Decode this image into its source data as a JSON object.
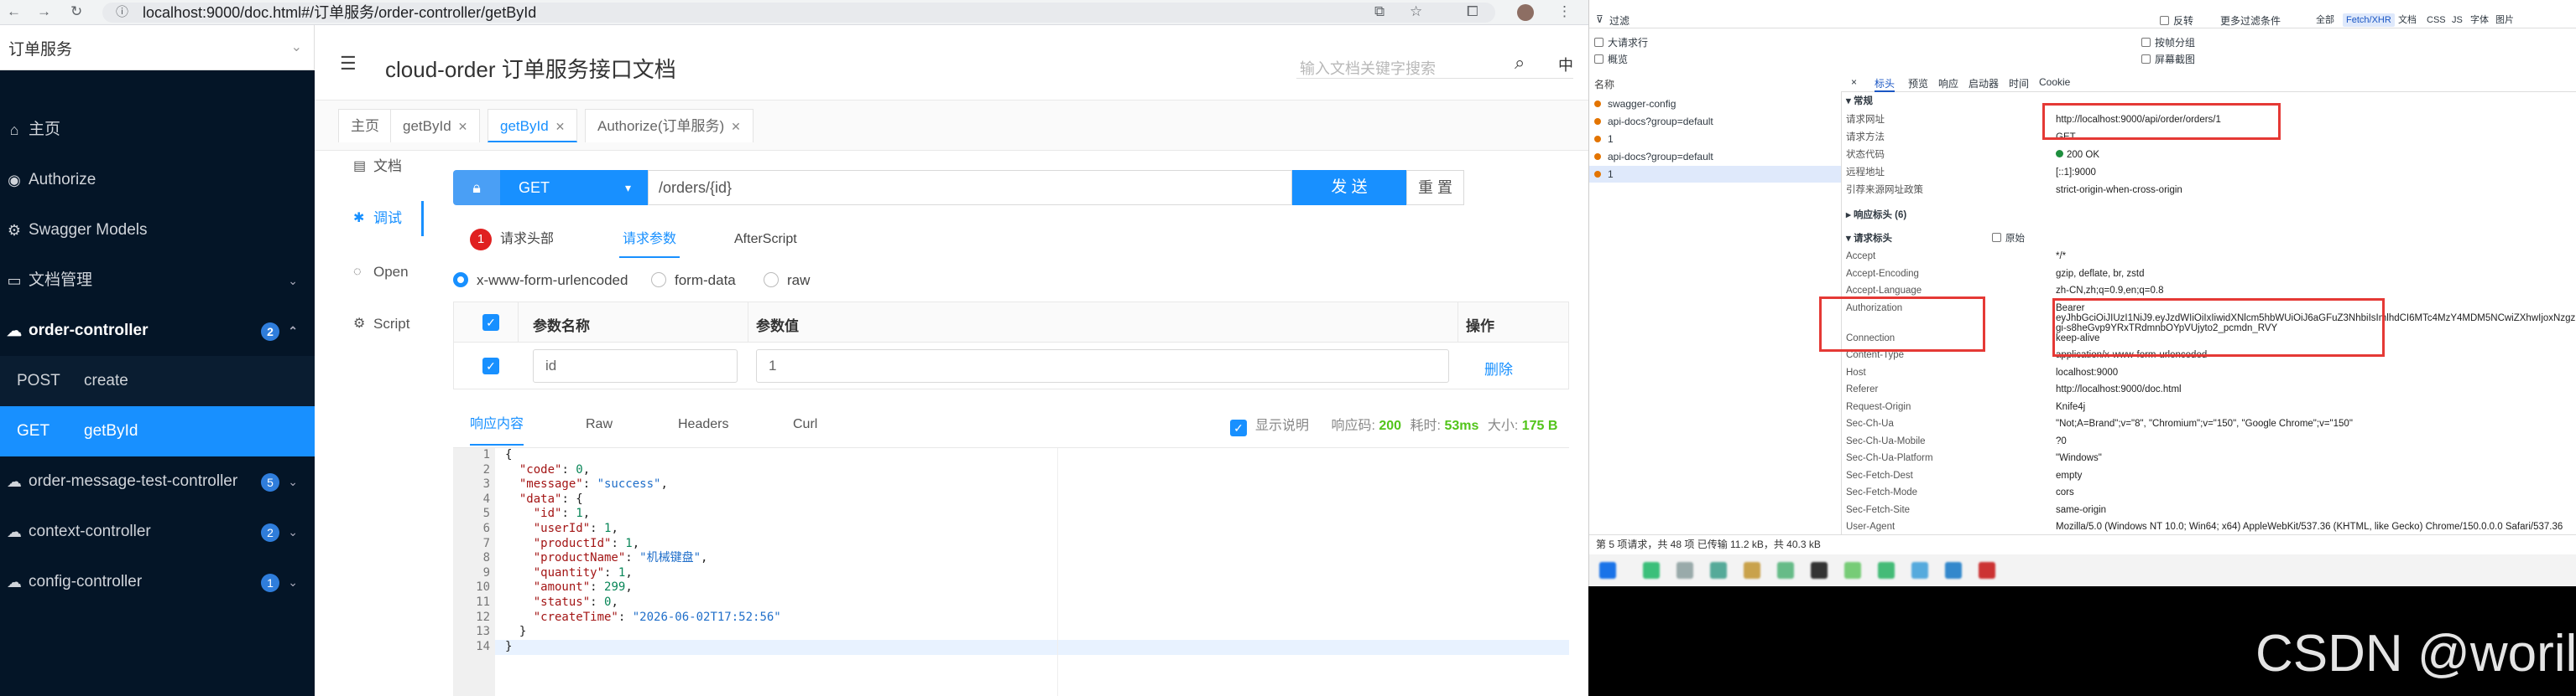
{
  "browser": {
    "url": "localhost:9000/doc.html#/订单服务/order-controller/getById"
  },
  "sidebar": {
    "service_select": "订单服务",
    "items": [
      {
        "label": "主页",
        "icon": "home-icon"
      },
      {
        "label": "Authorize",
        "icon": "shield-icon"
      },
      {
        "label": "Swagger Models",
        "icon": "model-icon"
      },
      {
        "label": "文档管理",
        "icon": "folder-icon"
      },
      {
        "label": "order-controller",
        "badge": "2",
        "icon": "cloud-icon"
      },
      {
        "label": "order-message-test-controller",
        "badge": "5",
        "icon": "cloud-icon"
      },
      {
        "label": "context-controller",
        "badge": "2",
        "icon": "cloud-icon"
      },
      {
        "label": "config-controller",
        "badge": "1",
        "icon": "cloud-icon"
      }
    ],
    "sub_items": [
      {
        "method": "POST",
        "path": "create"
      },
      {
        "method": "GET",
        "path": "getById"
      }
    ]
  },
  "header": {
    "title": "cloud-order 订单服务接口文档",
    "search_placeholder": "输入文档关键字搜索",
    "lang": "中"
  },
  "tabs": [
    "主页",
    "getById",
    "getById",
    "Authorize(订单服务)"
  ],
  "left_nav": [
    "文档",
    "调试",
    "Open",
    "Script"
  ],
  "request": {
    "method": "GET",
    "path": "/orders/{id}",
    "send": "发 送",
    "reset": "重 置"
  },
  "param_tabs": {
    "badge": "1",
    "items": [
      "请求头部",
      "请求参数",
      "AfterScript"
    ]
  },
  "content_types": [
    "x-www-form-urlencoded",
    "form-data",
    "raw"
  ],
  "param_table": {
    "headers": [
      "参数名称",
      "参数值",
      "操作"
    ],
    "row": {
      "name": "id",
      "value": "1",
      "action": "删除"
    }
  },
  "response": {
    "tabs": [
      "响应内容",
      "Raw",
      "Headers",
      "Curl"
    ],
    "show_desc": "显示说明",
    "code_label": "响应码:",
    "code": "200",
    "time_label": "耗时:",
    "time": "53ms",
    "size_label": "大小:",
    "size": "175 B",
    "lines": [
      "1",
      "2",
      "3",
      "4",
      "5",
      "6",
      "7",
      "8",
      "9",
      "10",
      "11",
      "12",
      "13",
      "14"
    ]
  },
  "devtools": {
    "filter_label": "过滤",
    "invert": "反转",
    "more_filters": "更多过滤条件",
    "all": "全部",
    "types": [
      "Fetch/XHR",
      "文档",
      "CSS",
      "JS",
      "字体",
      "图片"
    ],
    "big_rows": "大请求行",
    "overview": "概览",
    "group_by_frame": "按帧分组",
    "screenshot": "屏幕截图",
    "name_header": "名称",
    "detail_tabs": [
      "×",
      "标头",
      "预览",
      "响应",
      "启动器",
      "时间",
      "Cookie"
    ],
    "requests": [
      "swagger-config",
      "api-docs?group=default",
      "1",
      "api-docs?group=default",
      "1"
    ],
    "general_title": "▾ 常规",
    "general": [
      {
        "k": "请求网址",
        "v": "http://localhost:9000/api/order/orders/1"
      },
      {
        "k": "请求方法",
        "v": "GET"
      },
      {
        "k": "状态代码",
        "v": "200 OK"
      },
      {
        "k": "远程地址",
        "v": "[::1]:9000"
      },
      {
        "k": "引荐来源网址政策",
        "v": "strict-origin-when-cross-origin"
      }
    ],
    "resp_headers_title": "▸ 响应标头 (6)",
    "req_headers_title": "▾ 请求标头",
    "raw": "原始",
    "req_headers": [
      {
        "k": "Accept",
        "v": "*/*"
      },
      {
        "k": "Accept-Encoding",
        "v": "gzip, deflate, br, zstd"
      },
      {
        "k": "Accept-Language",
        "v": "zh-CN,zh;q=0.9,en;q=0.8"
      },
      {
        "k": "Authorization",
        "v": "Bearer"
      },
      {
        "k": "",
        "v": "eyJhbGciOiJIUzI1NiJ9.eyJzdWIiOiIxIiwidXNlcm5hbWUiOiJ6aGFuZ3NhbiIsImlhdCI6MTc4MzY4MDM5NCwiZXhwIjoxNzgzNzY2Nzk0fQ.Sv"
      },
      {
        "k": "",
        "v": "gi-s8heGvp9YRxTRdmnbOYpVUjyto2_pcmdn_RVY"
      },
      {
        "k": "Connection",
        "v": "keep-alive"
      },
      {
        "k": "Content-Type",
        "v": "application/x-www-form-urlencoded"
      },
      {
        "k": "Host",
        "v": "localhost:9000"
      },
      {
        "k": "Referer",
        "v": "http://localhost:9000/doc.html"
      },
      {
        "k": "Request-Origin",
        "v": "Knife4j"
      },
      {
        "k": "Sec-Ch-Ua",
        "v": "\"Not;A=Brand\";v=\"8\", \"Chromium\";v=\"150\", \"Google Chrome\";v=\"150\""
      },
      {
        "k": "Sec-Ch-Ua-Mobile",
        "v": "?0"
      },
      {
        "k": "Sec-Ch-Ua-Platform",
        "v": "\"Windows\""
      },
      {
        "k": "Sec-Fetch-Dest",
        "v": "empty"
      },
      {
        "k": "Sec-Fetch-Mode",
        "v": "cors"
      },
      {
        "k": "Sec-Fetch-Site",
        "v": "same-origin"
      },
      {
        "k": "User-Agent",
        "v": "Mozilla/5.0 (Windows NT 10.0; Win64; x64) AppleWebKit/537.36 (KHTML, like Gecko) Chrome/150.0.0.0 Safari/537.36"
      }
    ],
    "status_bar": "第 5 项请求，共 48 项    已传输 11.2 kB，共 40.3 kB"
  },
  "watermark": "CSDN @worilb",
  "colors": {
    "accent": "#1890ff",
    "sidebar": "#041527",
    "highlight": "#e53935"
  }
}
